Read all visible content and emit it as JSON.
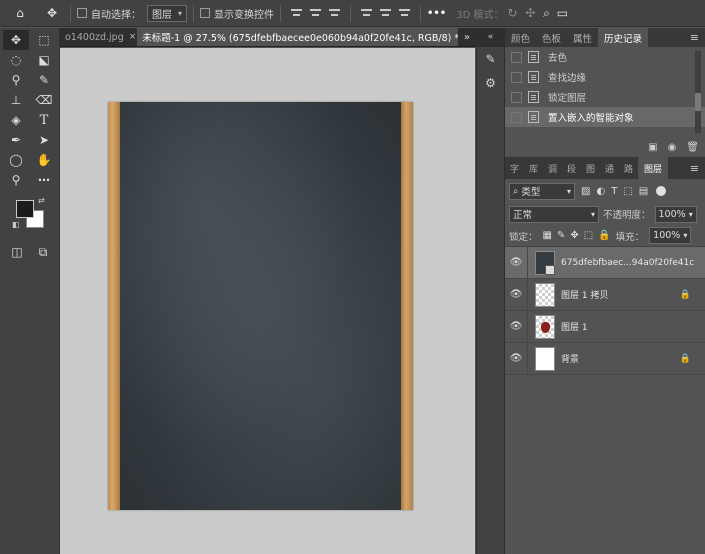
{
  "options_bar": {
    "auto_select_label": "自动选择：",
    "auto_select_value": "图层",
    "show_transform_label": "显示变换控件",
    "mode_3d_label": "3D 模式：",
    "more": "•••"
  },
  "tools": {
    "text_tool": "T"
  },
  "document_tabs": [
    {
      "label": "o1400zd.jpg",
      "close": "×"
    },
    {
      "label": "未标题-1 @ 27.5% (675dfebfbaecee0e060b94a0f20fe41c, RGB/8) *",
      "close": "×"
    }
  ],
  "tabs_more": "»",
  "panel_tabs": [
    "颜色",
    "色板",
    "属性",
    "历史记录"
  ],
  "history": [
    {
      "label": "去色",
      "selected": false
    },
    {
      "label": "查找边缘",
      "selected": false
    },
    {
      "label": "锁定图层",
      "selected": false
    },
    {
      "label": "置入嵌入的智能对象",
      "selected": true
    }
  ],
  "layers_tabs": [
    "字",
    "库",
    "调",
    "段",
    "图",
    "通",
    "路",
    "图层"
  ],
  "layers": {
    "filter_label": "类型",
    "blend_mode": "正常",
    "opacity_label": "不透明度：",
    "opacity_value": "100%",
    "lock_label": "锁定：",
    "fill_label": "填充：",
    "fill_value": "100%",
    "items": [
      {
        "name": "675dfebfbaec...94a0f20fe41c",
        "thumb": "dark",
        "selected": true,
        "locked": false
      },
      {
        "name": "图层 1 拷贝",
        "thumb": "checker",
        "selected": false,
        "locked": true
      },
      {
        "name": "图层 1",
        "thumb": "red",
        "selected": false,
        "locked": false
      },
      {
        "name": "背景",
        "thumb": "white",
        "selected": false,
        "locked": true
      }
    ]
  },
  "colors": {
    "chalkboard": "#343b40",
    "wood": "#c99a60",
    "canvas_bg": "#cbcbcb"
  }
}
